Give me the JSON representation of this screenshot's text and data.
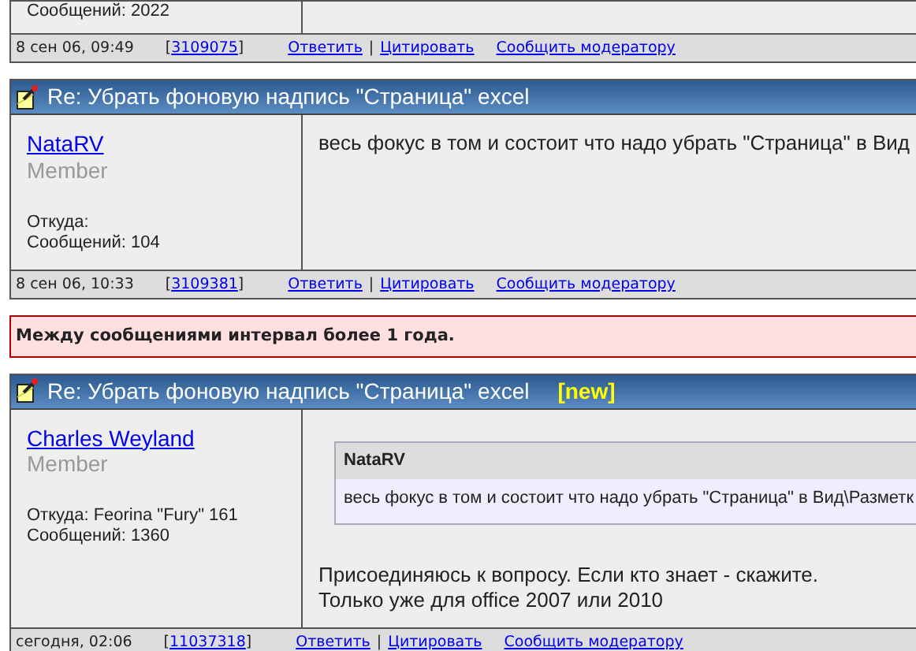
{
  "thread": [
    {
      "kind": "post",
      "messages": "Сообщений: 2022",
      "footer": {
        "date": "8 сен 06, 09:49",
        "ref_open": "[",
        "ref": "3109075",
        "ref_close": "]",
        "links": [
          "Ответить",
          "Цитировать",
          "Сообщить модератору"
        ],
        "separator": "|"
      }
    },
    {
      "kind": "post",
      "title": "Re: Убрать фоновую надпись \"Страница\" excel",
      "author": "NataRV",
      "rank": "Member",
      "location": "Откуда:",
      "messages": "Сообщений: 104",
      "body": [
        "весь фокус в том и состоит что надо убрать \"Страница\" в Вид"
      ],
      "footer": {
        "date": "8 сен 06, 10:33",
        "ref_open": "[",
        "ref": "3109381",
        "ref_close": "]",
        "links": [
          "Ответить",
          "Цитировать",
          "Сообщить модератору"
        ],
        "separator": "|"
      }
    },
    {
      "kind": "notice",
      "text": "Между сообщениями интервал более 1 года."
    },
    {
      "kind": "post",
      "title": "Re: Убрать фоновую надпись \"Страница\" excel",
      "author": "Charles Weyland",
      "rank": "Member",
      "location": "Откуда: Feorina \"Fury\" 161",
      "messages": "Сообщений: 1360",
      "body": [
        "Присоединяюсь к вопросу. Если кто знает - скажите.",
        "Только уже для office 2007 или 2010"
      ],
      "quote": {
        "author": "NataRV",
        "text": "весь фокус в том и состоит что надо убрать \"Страница\" в Вид\\Разметк"
      },
      "new_badge": "[new]",
      "footer": {
        "date": "сегодня, 02:06",
        "ref_open": "[",
        "ref": "11037318",
        "ref_close": "]",
        "links": [
          "Ответить",
          "Цитировать",
          "Сообщить модератору"
        ],
        "separator": "|"
      }
    }
  ]
}
